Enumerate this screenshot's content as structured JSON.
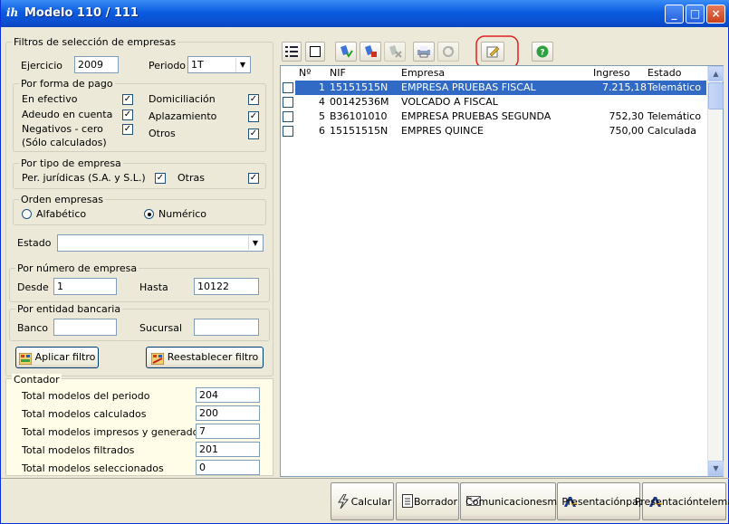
{
  "window": {
    "title": "Modelo 110 / 111",
    "app_logo": "ih",
    "controls": {
      "minimize": "_",
      "maximize": "□",
      "close": "×"
    }
  },
  "filters": {
    "legend": "Filtros de selección de empresas",
    "ejercicio_label": "Ejercicio",
    "ejercicio_value": "2009",
    "periodo_label": "Periodo",
    "periodo_value": "1T"
  },
  "forma_pago": {
    "legend": "Por forma de pago",
    "en_efectivo": "En efectivo",
    "domiciliacion": "Domiciliación",
    "adeudo": "Adeudo en cuenta",
    "aplazamiento": "Aplazamiento",
    "negativos": "Negativos - cero",
    "solo_calculados": "(Sólo calculados)",
    "otros": "Otros",
    "check": "✓"
  },
  "tipo_empresa": {
    "legend": "Por tipo de empresa",
    "juridicas": "Per. jurídicas (S.A. y S.L.)",
    "otras": "Otras"
  },
  "orden": {
    "legend": "Orden empresas",
    "alfabetico": "Alfabético",
    "numerico": "Numérico",
    "selected": "Numérico"
  },
  "estado": {
    "label": "Estado",
    "value": ""
  },
  "numero_empresa": {
    "legend": "Por número de empresa",
    "desde_label": "Desde",
    "desde_value": "1",
    "hasta_label": "Hasta",
    "hasta_value": "10122"
  },
  "entidad": {
    "legend": "Por entidad bancaria",
    "banco_label": "Banco",
    "banco_value": "",
    "sucursal_label": "Sucursal",
    "sucursal_value": ""
  },
  "buttons": {
    "aplicar": "Aplicar filtro",
    "reestablecer": "Reestablecer filtro"
  },
  "contador": {
    "legend": "Contador",
    "rows": [
      {
        "label": "Total modelos del periodo",
        "value": "204"
      },
      {
        "label": "Total modelos calculados",
        "value": "200"
      },
      {
        "label": "Total modelos impresos y generados",
        "value": "7"
      },
      {
        "label": "Total modelos filtrados",
        "value": "201"
      },
      {
        "label": "Total modelos seleccionados",
        "value": "0"
      }
    ]
  },
  "grid": {
    "columns": {
      "num": "Nº",
      "nif": "NIF",
      "empresa": "Empresa",
      "ingreso": "Ingreso",
      "estado": "Estado"
    },
    "rows": [
      {
        "num": "1",
        "nif": "15151515N",
        "empresa": "EMPRESA PRUEBAS  FISCAL",
        "ingreso": "7.215,18",
        "estado": "Telemático",
        "selected": true
      },
      {
        "num": "4",
        "nif": "00142536M",
        "empresa": "VOLCADO A  FISCAL",
        "ingreso": "",
        "estado": "",
        "selected": false
      },
      {
        "num": "5",
        "nif": "B36101010",
        "empresa": "EMPRESA PRUEBAS SEGUNDA",
        "ingreso": "752,30",
        "estado": "Telemático",
        "selected": false
      },
      {
        "num": "6",
        "nif": "15151515N",
        "empresa": "EMPRES QUINCE",
        "ingreso": "750,00",
        "estado": "Calculada",
        "selected": false
      }
    ]
  },
  "toolbar": {
    "icons": [
      "list-view-icon",
      "deselect-icon",
      "check-all-icon",
      "calculate-icon",
      "delete-icon",
      "print-icon",
      "refresh-icon",
      "edit-icon",
      "help-icon"
    ]
  },
  "footer": {
    "calcular": "Calcular",
    "borrador": "Borrador",
    "comunicaciones_1": "Comunicaciones",
    "comunicaciones_2": "mail",
    "papel_1": "Presentación",
    "papel_2": "papel",
    "telematica_1": "Presentación",
    "telematica_2": "telemática"
  },
  "colors": {
    "title_bar": "#0a5ce0",
    "selection": "#316ac5",
    "highlight_ring": "#e02020",
    "counter_bg": "#fffde8"
  }
}
